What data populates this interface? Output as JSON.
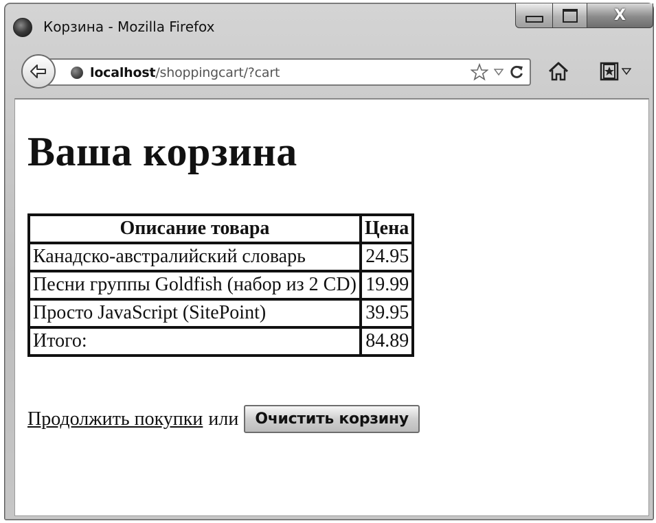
{
  "window": {
    "title": "Корзина - Mozilla Firefox",
    "close_glyph": "X"
  },
  "navbar": {
    "url_host": "localhost",
    "url_path": "/shoppingcart/?cart"
  },
  "page": {
    "heading": "Ваша корзина",
    "table": {
      "headers": [
        "Описание товара",
        "Цена"
      ],
      "rows": [
        {
          "description": "Канадско-австралийский словарь",
          "price": "24.95"
        },
        {
          "description": "Песни группы Goldfish (набор из 2 CD)",
          "price": "19.99"
        },
        {
          "description": "Просто JavaScript (SitePoint)",
          "price": "39.95"
        }
      ],
      "total_label": "Итого:",
      "total_value": "84.89"
    },
    "continue_link": "Продолжить покупки",
    "connector": "или",
    "clear_button": "Очистить корзину"
  },
  "icons": [
    "firefox-icon",
    "minimize-icon",
    "maximize-icon",
    "close-icon",
    "back-arrow-icon",
    "globe-icon",
    "star-icon",
    "dropdown-triangle-icon",
    "reload-icon",
    "home-icon",
    "bookmarks-icon"
  ]
}
